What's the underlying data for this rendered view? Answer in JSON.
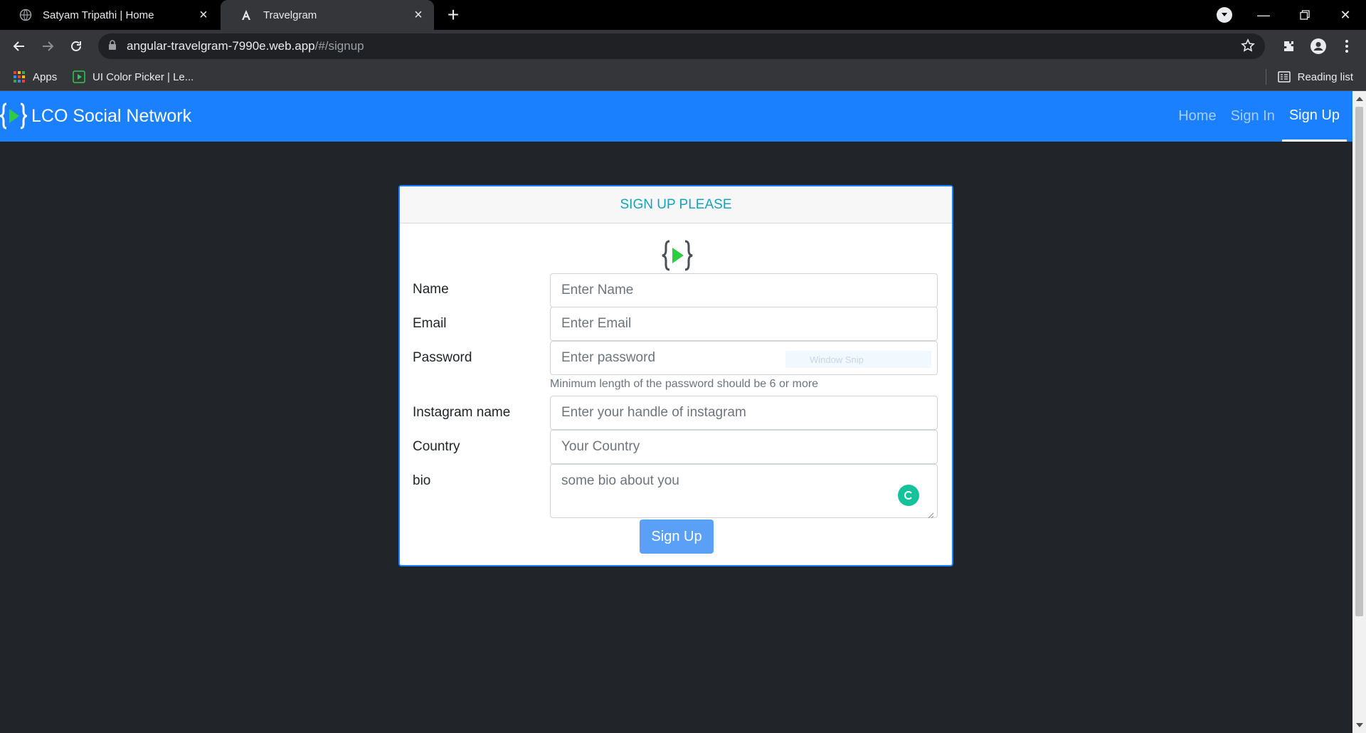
{
  "browser": {
    "tabs": [
      {
        "title": "Satyam Tripathi | Home",
        "active": false
      },
      {
        "title": "Travelgram",
        "active": true
      }
    ],
    "url_host": "angular-travelgram-7990e.web.app",
    "url_path": "/#/signup",
    "bookmarks": [
      {
        "label": "Apps",
        "icon": "apps-grid-icon"
      },
      {
        "label": "UI Color Picker | Le...",
        "icon": "green-play-icon"
      }
    ],
    "reading_list_label": "Reading list"
  },
  "navbar": {
    "brand": "LCO Social Network",
    "links": [
      {
        "label": "Home",
        "active": false
      },
      {
        "label": "Sign In",
        "active": false
      },
      {
        "label": "Sign Up",
        "active": true
      }
    ],
    "color": "#1a80fe"
  },
  "signup": {
    "header": "SIGN UP PLEASE",
    "fields": {
      "name": {
        "label": "Name",
        "placeholder": "Enter Name"
      },
      "email": {
        "label": "Email",
        "placeholder": "Enter Email"
      },
      "password": {
        "label": "Password",
        "placeholder": "Enter password",
        "help": "Minimum length of the password should be 6 or more"
      },
      "instagram": {
        "label": "Instagram name",
        "placeholder": "Enter your handle of instagram"
      },
      "country": {
        "label": "Country",
        "placeholder": "Your Country"
      },
      "bio": {
        "label": "bio",
        "placeholder": "some bio about you"
      }
    },
    "submit_label": "Sign Up"
  },
  "overlay": {
    "ghost_tooltip": "Window Snip"
  },
  "colors": {
    "page_bg": "#212529",
    "header_text": "#17a2b8",
    "button_bg": "#5aa0f7",
    "logo_green": "#2ecc40"
  }
}
